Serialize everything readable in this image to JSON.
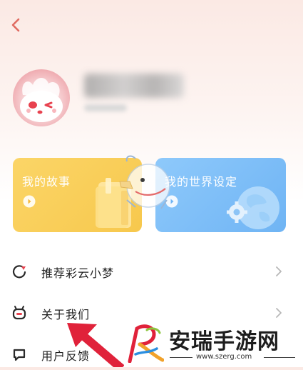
{
  "header": {
    "back_icon": "chevron-left-icon"
  },
  "profile": {
    "avatar_icon": "cartoon-avatar"
  },
  "cards": [
    {
      "title": "我的故事",
      "color": "#f9cf5c",
      "icon": "book-icon"
    },
    {
      "title": "我的世界设定",
      "color": "#7fbef8",
      "icon": "globe-gear-icon"
    }
  ],
  "menu": [
    {
      "label": "推荐彩云小梦",
      "icon": "share-circle-icon"
    },
    {
      "label": "关于我们",
      "icon": "robot-face-icon"
    },
    {
      "label": "用户反馈",
      "icon": "chat-bubble-icon"
    }
  ],
  "watermark": {
    "title": "安瑞手游网",
    "url": "www.szerg.com",
    "accent_color": "#e0223a"
  }
}
